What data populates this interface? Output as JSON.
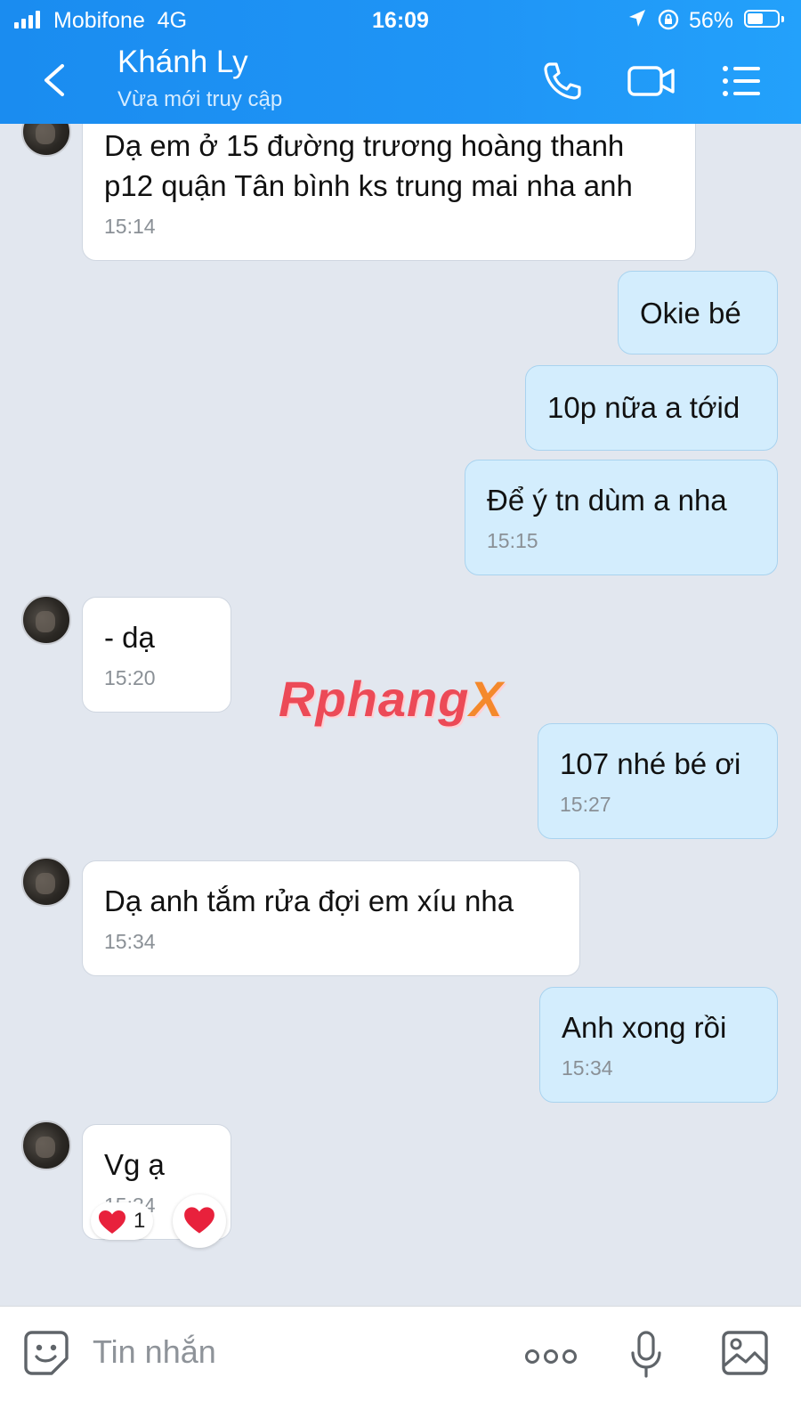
{
  "status_bar": {
    "carrier": "Mobifone",
    "network": "4G",
    "time": "16:09",
    "battery": "56%",
    "battery_level": 0.56
  },
  "header": {
    "contact_name": "Khánh Ly",
    "contact_status": "Vừa mới truy cập",
    "icons": [
      "back-icon",
      "phone-icon",
      "video-call-icon",
      "menu-icon"
    ]
  },
  "messages": [
    {
      "side": "in",
      "text": "Dạ em ở 15 đường trương hoàng thanh\np12 quận Tân bình ks trung mai nha anh",
      "time": "15:14"
    },
    {
      "side": "out",
      "text": "Okie bé",
      "time": ""
    },
    {
      "side": "out",
      "text": "10p nữa a tớid",
      "time": ""
    },
    {
      "side": "out",
      "text": "Để ý tn dùm a nha",
      "time": "15:15"
    },
    {
      "side": "in",
      "text": "- dạ",
      "time": "15:20"
    },
    {
      "side": "out",
      "text": "107 nhé bé ơi",
      "time": "15:27"
    },
    {
      "side": "in",
      "text": "Dạ anh tắm rửa đợi em xíu nha",
      "time": "15:34"
    },
    {
      "side": "out",
      "text": "Anh xong rồi",
      "time": "15:34"
    },
    {
      "side": "in",
      "text": "Vg ạ",
      "time": "15:34"
    }
  ],
  "reaction": {
    "emoji": "heart",
    "count": "1"
  },
  "watermark": {
    "main": "Rphang",
    "tail": "X"
  },
  "composer": {
    "placeholder": "Tin nhắn",
    "icons": [
      "sticker-icon",
      "more-icon",
      "microphone-icon",
      "image-icon"
    ]
  },
  "colors": {
    "header": "#1f95f6",
    "incoming_bubble": "#ffffff",
    "outgoing_bubble": "#d3edfd",
    "background": "#e2e7ef"
  }
}
